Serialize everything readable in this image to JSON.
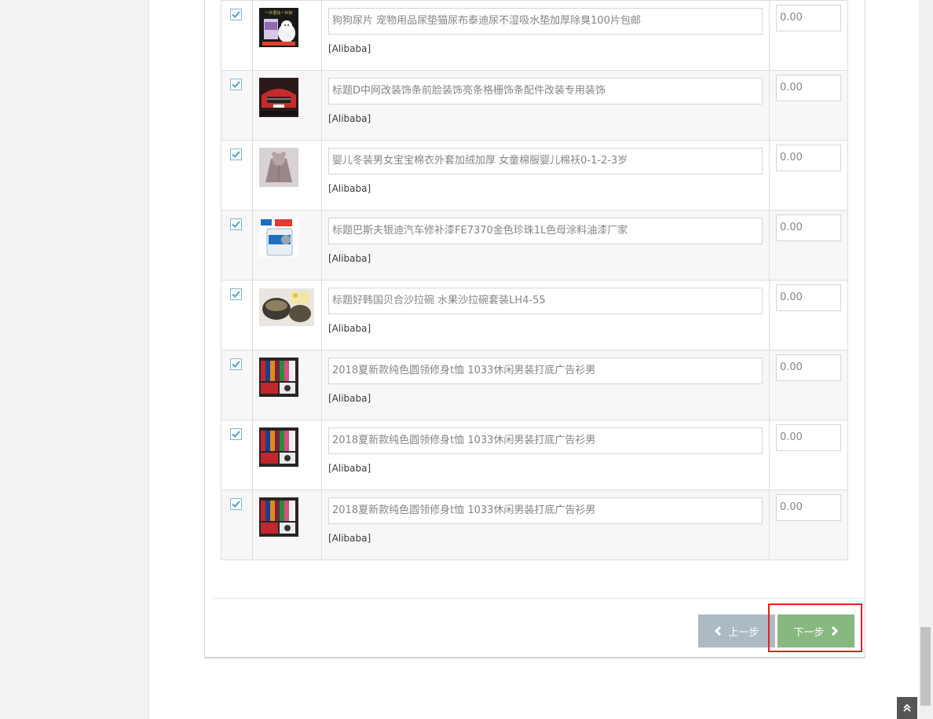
{
  "rows": [
    {
      "title": "狗狗尿片 宠物用品尿垫猫尿布泰迪尿不湿吸水垫加厚除臭100片包邮",
      "source": "[Alibaba]",
      "price": "0.00",
      "checked": true,
      "image": "pet-diaper-product-image"
    },
    {
      "title": "标题D中网改装饰条前脸装饰亮条格栅饰条配件改装专用装饰",
      "source": "[Alibaba]",
      "price": "0.00",
      "checked": true,
      "image": "car-grille-product-image"
    },
    {
      "title": "婴儿冬装男女宝宝棉衣外套加绒加厚 女童棉服婴儿棉袄0-1-2-3岁",
      "source": "[Alibaba]",
      "price": "0.00",
      "checked": true,
      "image": "baby-coat-product-image"
    },
    {
      "title": "标题巴斯夫银迪汽车修补漆FE7370金色珍珠1L色母涂料油漆厂家",
      "source": "[Alibaba]",
      "price": "0.00",
      "checked": true,
      "image": "paint-can-product-image"
    },
    {
      "title": "标题好韩国贝合沙拉碗 水果沙拉碗套装LH4-55",
      "source": "[Alibaba]",
      "price": "0.00",
      "checked": true,
      "image": "salad-bowl-product-image"
    },
    {
      "title": "2018夏新款纯色圆领修身t恤 1033休闲男装打底广告衫男",
      "source": "[Alibaba]",
      "price": "0.00",
      "checked": true,
      "image": "tshirt-product-image"
    },
    {
      "title": "2018夏新款纯色圆领修身t恤 1033休闲男装打底广告衫男",
      "source": "[Alibaba]",
      "price": "0.00",
      "checked": true,
      "image": "tshirt-product-image"
    },
    {
      "title": "2018夏新款纯色圆领修身t恤 1033休闲男装打底广告衫男",
      "source": "[Alibaba]",
      "price": "0.00",
      "checked": true,
      "image": "tshirt-product-image"
    }
  ],
  "thumbnail_text": {
    "pet_diaper_banner": "一片更比一片好"
  },
  "buttons": {
    "prev_label": "上一步",
    "prev_icon": "chevron-left-icon",
    "next_label": "下一步",
    "next_icon": "chevron-right-icon",
    "back_to_top_icon": "double-chevron-up-icon"
  },
  "colors": {
    "prev_button": "#abbac3",
    "next_button": "#87b87f",
    "highlight_border": "#e0201e",
    "checkbox_accent": "#4a9fd1"
  }
}
